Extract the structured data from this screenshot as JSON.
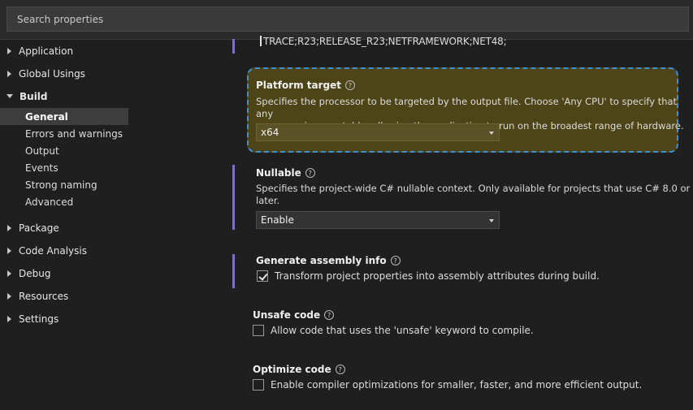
{
  "search": {
    "placeholder": "Search properties"
  },
  "sidebar": {
    "items": [
      {
        "label": "Application",
        "expanded": false
      },
      {
        "label": "Global Usings",
        "expanded": false
      },
      {
        "label": "Build",
        "expanded": true
      },
      {
        "label": "Package",
        "expanded": false
      },
      {
        "label": "Code Analysis",
        "expanded": false
      },
      {
        "label": "Debug",
        "expanded": false
      },
      {
        "label": "Resources",
        "expanded": false
      },
      {
        "label": "Settings",
        "expanded": false
      }
    ],
    "build_children": [
      "General",
      "Errors and warnings",
      "Output",
      "Events",
      "Strong naming",
      "Advanced"
    ],
    "selected": "General"
  },
  "main": {
    "constants_text": "TRACE;R23;RELEASE_R23;NETFRAMEWORK;NET48;",
    "platform_target": {
      "title": "Platform target",
      "desc_line1": "Specifies the processor to be targeted by the output file. Choose 'Any CPU' to specify that any",
      "desc_line2": "processor is acceptable, allowing the application to run on the broadest range of hardware.",
      "value": "x64"
    },
    "nullable": {
      "title": "Nullable",
      "desc_line1": "Specifies the project-wide C# nullable context. Only available for projects that use C# 8.0 or",
      "desc_line2": "later.",
      "value": "Enable"
    },
    "generate_assembly_info": {
      "title": "Generate assembly info",
      "checkbox_label": "Transform project properties into assembly attributes during build.",
      "checked": true
    },
    "unsafe_code": {
      "title": "Unsafe code",
      "checkbox_label": "Allow code that uses the 'unsafe' keyword to compile.",
      "checked": false
    },
    "optimize_code": {
      "title": "Optimize code",
      "checkbox_label": "Enable compiler optimizations for smaller, faster, and more efficient output.",
      "checked": false
    },
    "help_glyph": "?"
  },
  "colors": {
    "accent_bar": "#8271c2",
    "highlight_bg": "#4d4517",
    "highlight_border": "#3b8fd6",
    "selected_bg": "#3d3d3d"
  }
}
